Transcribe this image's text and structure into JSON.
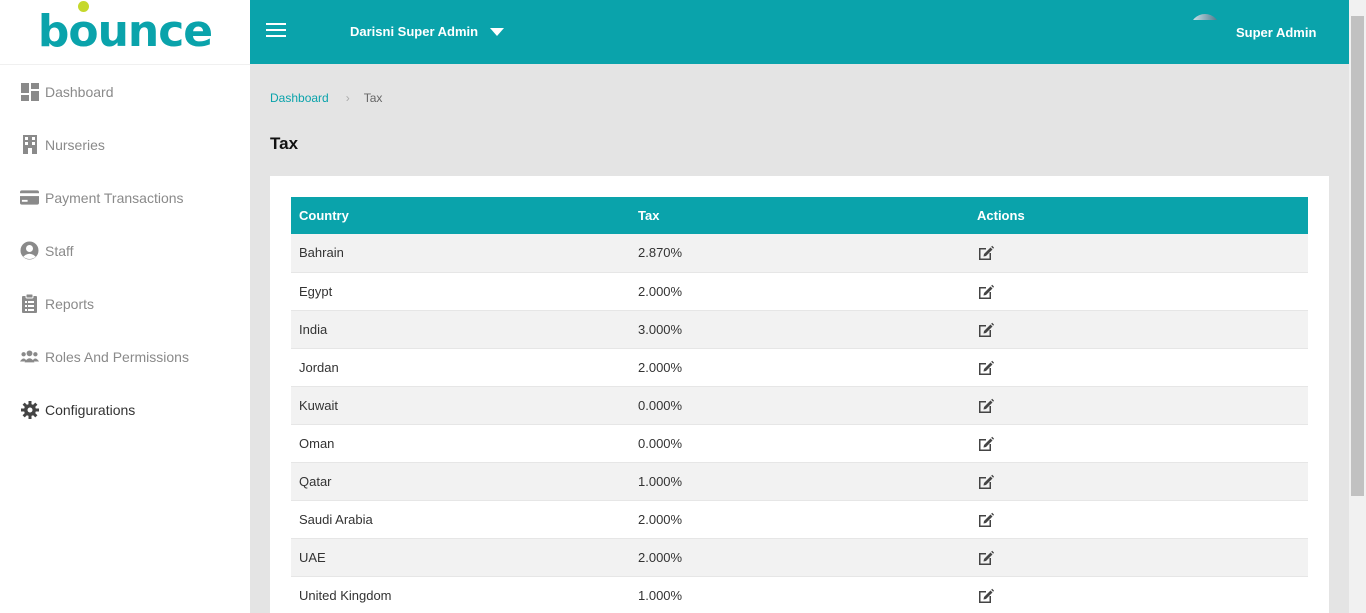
{
  "sidebar": {
    "logo_text": "bounce",
    "items": [
      {
        "label": "Dashboard",
        "icon": "dashboard-icon"
      },
      {
        "label": "Nurseries",
        "icon": "building-icon"
      },
      {
        "label": "Payment Transactions",
        "icon": "credit-card-icon"
      },
      {
        "label": "Staff",
        "icon": "user-circle-icon"
      },
      {
        "label": "Reports",
        "icon": "clipboard-list-icon"
      },
      {
        "label": "Roles And Permissions",
        "icon": "users-icon"
      },
      {
        "label": "Configurations",
        "icon": "gear-icon"
      }
    ],
    "active_index": 6
  },
  "header": {
    "org_name": "Darisni Super Admin",
    "user_name": "Super Admin"
  },
  "breadcrumb": {
    "home": "Dashboard",
    "current": "Tax"
  },
  "page_title": "Tax",
  "table": {
    "headers": [
      "Country",
      "Tax",
      "Actions"
    ],
    "rows": [
      {
        "country": "Bahrain",
        "tax": "2.870%"
      },
      {
        "country": "Egypt",
        "tax": "2.000%"
      },
      {
        "country": "India",
        "tax": "3.000%"
      },
      {
        "country": "Jordan",
        "tax": "2.000%"
      },
      {
        "country": "Kuwait",
        "tax": "0.000%"
      },
      {
        "country": "Oman",
        "tax": "0.000%"
      },
      {
        "country": "Qatar",
        "tax": "1.000%"
      },
      {
        "country": "Saudi Arabia",
        "tax": "2.000%"
      },
      {
        "country": "UAE",
        "tax": "2.000%"
      },
      {
        "country": "United Kingdom",
        "tax": "1.000%"
      }
    ],
    "action_icon": "edit-icon"
  },
  "colors": {
    "brand": "#0aa3ab",
    "logo_dot": "#c5d82c"
  }
}
